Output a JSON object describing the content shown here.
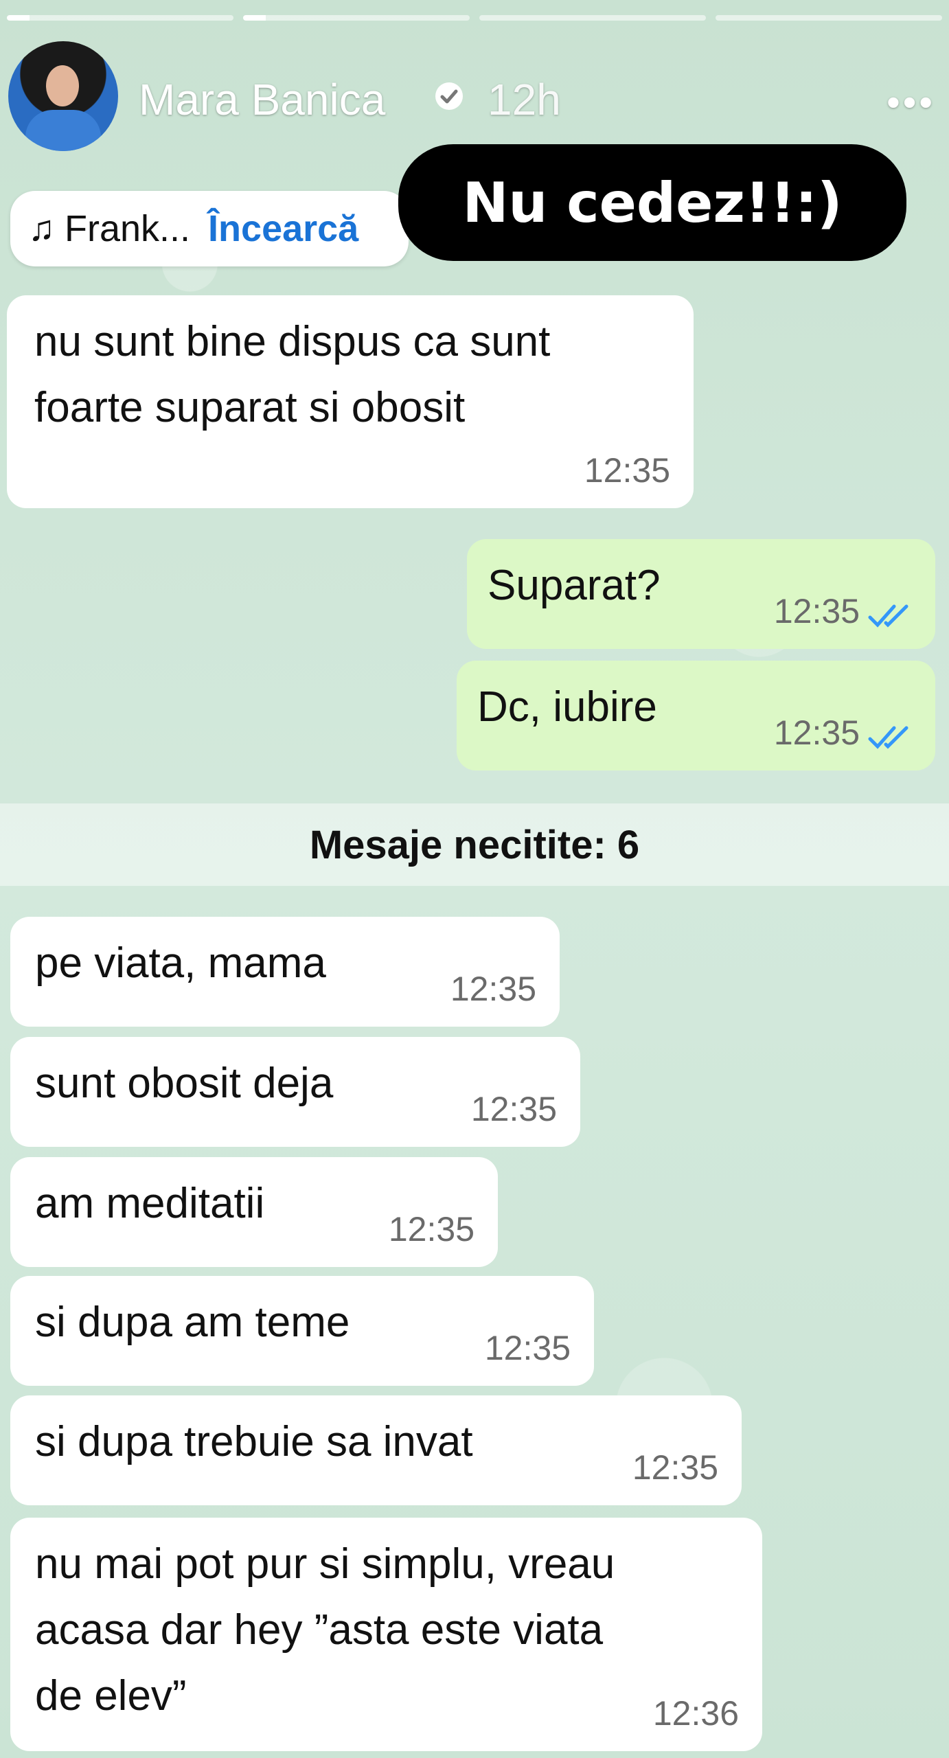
{
  "story": {
    "segments": 4,
    "username": "Mara Banica",
    "time_ago": "12h",
    "more_icon": "more-dots-icon",
    "verified_icon": "verified-badge-icon"
  },
  "music": {
    "song": "Frank...",
    "action": "Încearcă",
    "icon": "music-note-icon"
  },
  "sticker": {
    "text": "Nu cedez!!:)"
  },
  "chat": {
    "messages_top": [
      {
        "dir": "in",
        "text": "nu sunt bine dispus ca sunt\nfoarte suparat si obosit",
        "time": "12:35"
      },
      {
        "dir": "out",
        "text": "Suparat?",
        "time": "12:35"
      },
      {
        "dir": "out",
        "text": "Dc, iubire",
        "time": "12:35"
      }
    ],
    "unread_label": "Mesaje necitite: 6",
    "messages_bottom": [
      {
        "dir": "in",
        "text": "pe viata, mama",
        "time": "12:35"
      },
      {
        "dir": "in",
        "text": "sunt obosit deja",
        "time": "12:35"
      },
      {
        "dir": "in",
        "text": "am meditatii",
        "time": "12:35"
      },
      {
        "dir": "in",
        "text": "si dupa am teme",
        "time": "12:35"
      },
      {
        "dir": "in",
        "text": "si dupa trebuie sa invat",
        "time": "12:35"
      },
      {
        "dir": "in",
        "text": "nu mai pot pur si simplu, vreau\nacasa dar hey ”asta este viata\nde elev”",
        "time": "12:36"
      }
    ],
    "colors": {
      "incoming": "#ffffff",
      "outgoing": "#dcf8c6",
      "read_ticks": "#3497f9"
    }
  }
}
